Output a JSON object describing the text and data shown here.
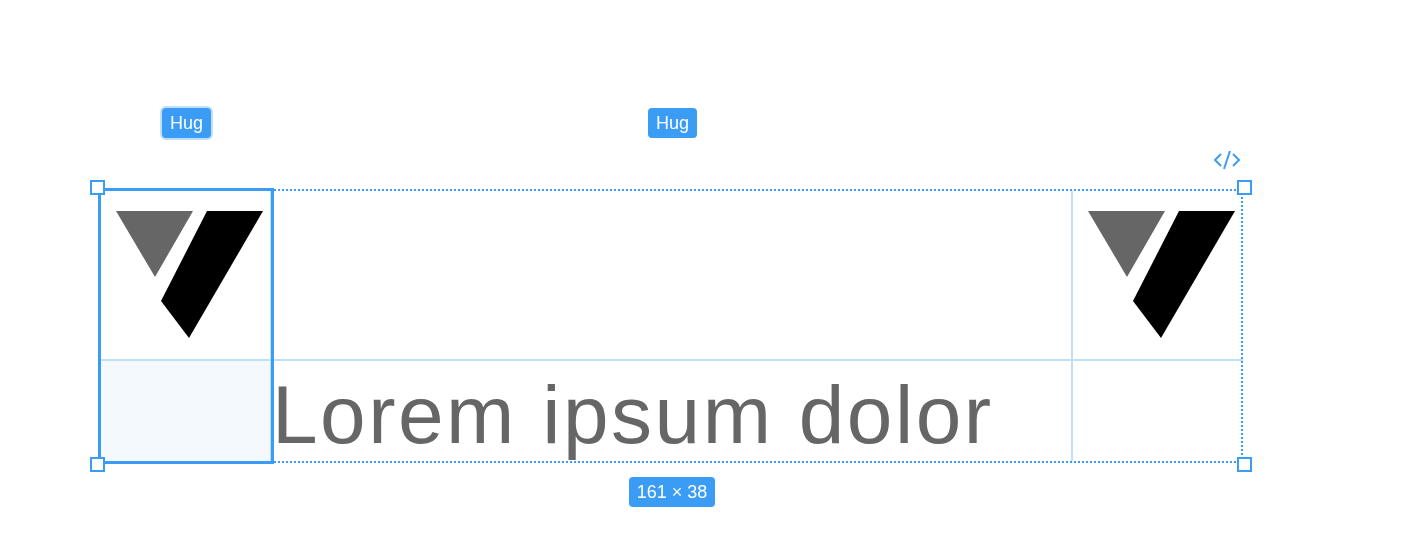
{
  "frame": {
    "columns": [
      {
        "selected": true,
        "hug_label": "Hug"
      },
      {
        "selected": false,
        "hug_label": "Hug"
      },
      {
        "selected": false
      }
    ],
    "text": "Lorem ipsum dolor",
    "size_badge": "161 × 38"
  }
}
